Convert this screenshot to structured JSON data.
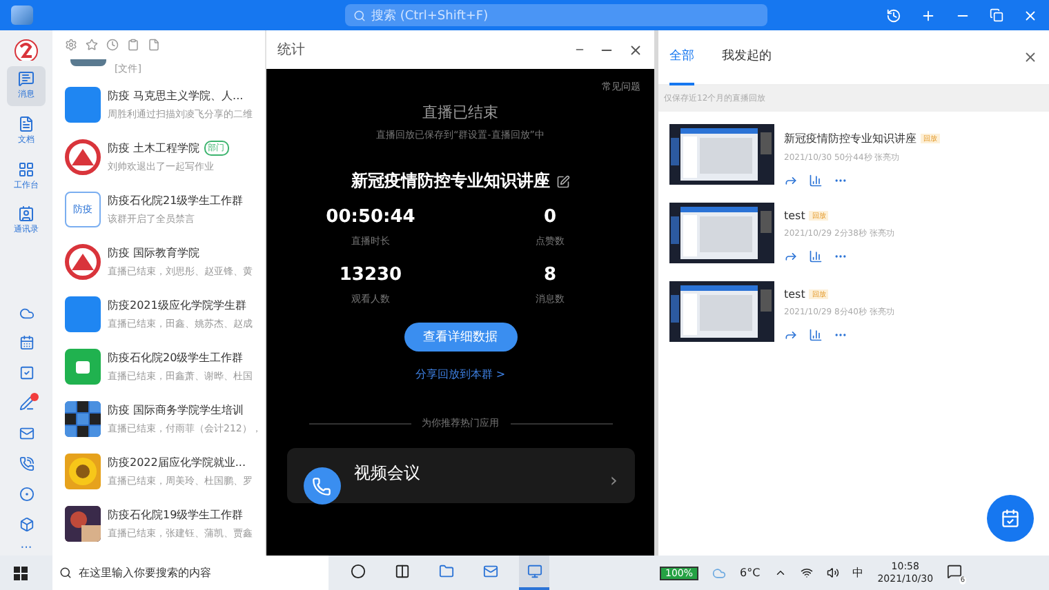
{
  "topbar": {
    "search_placeholder": "搜索 (Ctrl+Shift+F)"
  },
  "rail": {
    "items": [
      {
        "label": "消息",
        "selected": true
      },
      {
        "label": "文档",
        "selected": false
      },
      {
        "label": "工作台",
        "selected": false
      },
      {
        "label": "通讯录",
        "selected": false
      }
    ],
    "tools": [
      {
        "badge": false
      },
      {
        "badge": false
      },
      {
        "badge": false
      },
      {
        "badge": true
      },
      {
        "badge": false
      },
      {
        "badge": false
      },
      {
        "badge": false
      },
      {
        "badge": false
      }
    ],
    "more": "···"
  },
  "chats": {
    "partial_preview": "[文件]",
    "items": [
      {
        "name": "防疫 马克思主义学院、人...",
        "preview": "周胜利通过扫描刘凌飞分享的二维",
        "kind": "blue"
      },
      {
        "name": "防疫 土木工程学院",
        "tag": "部门",
        "preview": "刘帅欢退出了一起写作业",
        "kind": "emblem"
      },
      {
        "name": "防疫石化院21级学生工作群",
        "preview": "该群开启了全员禁言",
        "kind": "text",
        "avatar_text": "防疫"
      },
      {
        "name": "防疫 国际教育学院",
        "preview": "直播已结束，刘思彤、赵亚锋、黄",
        "kind": "emblem"
      },
      {
        "name": "防疫2021级应化学院学生群",
        "preview": "直播已结束，田鑫、姚苏杰、赵成",
        "kind": "blue"
      },
      {
        "name": "防疫石化院20级学生工作群",
        "preview": "直播已结束，田鑫萧、谢晔、杜国",
        "kind": "green"
      },
      {
        "name": "防疫 国际商务学院学生培训",
        "preview": "直播已结束，付雨菲（会计212），",
        "kind": "grid"
      },
      {
        "name": "防疫2022届应化学院就业...",
        "preview": "直播已结束，周美玲、杜国鹏、罗",
        "kind": "flower"
      },
      {
        "name": "防疫石化院19级学生工作群",
        "preview": "直播已结束，张建钰、蒲凯、贾鑫"
      }
    ]
  },
  "stats_window": {
    "title": "统计",
    "faq": "常见问题",
    "heading": "直播已结束",
    "note": "直播回放已保存到“群设置-直播回放”中",
    "lecture_title": "新冠疫情防控专业知识讲座",
    "stats": [
      {
        "value": "00:50:44",
        "label": "直播时长"
      },
      {
        "value": "0",
        "label": "点赞数"
      },
      {
        "value": "13230",
        "label": "观看人数"
      },
      {
        "value": "8",
        "label": "消息数"
      }
    ],
    "details_button": "查看详细数据",
    "share_link": "分享回放到本群 >",
    "recommend_heading": "为你推荐热门应用",
    "app_card": {
      "name": "视频会议",
      "chevron": "›"
    }
  },
  "replays": {
    "tabs": [
      {
        "label": "全部",
        "selected": true
      },
      {
        "label": "我发起的",
        "selected": false
      }
    ],
    "note": "仅保存近12个月的直播回放",
    "items": [
      {
        "title": "新冠疫情防控专业知识讲座",
        "badge": "回放",
        "meta": "2021/10/30 50分44秒 张亮功"
      },
      {
        "title": "test",
        "badge": "回放",
        "meta": "2021/10/29 2分38秒 张亮功"
      },
      {
        "title": "test",
        "badge": "回放",
        "meta": "2021/10/29 8分40秒 张亮功"
      }
    ]
  },
  "taskbar": {
    "search_placeholder": "在这里输入你要搜索的内容",
    "apps": [
      {
        "selected": false
      },
      {
        "selected": false
      },
      {
        "selected": false
      },
      {
        "selected": false
      },
      {
        "selected": true
      }
    ],
    "battery": "100%",
    "temperature": "6°C",
    "ime": "中",
    "time": "10:58",
    "date": "2021/10/30",
    "notifications": "6"
  }
}
